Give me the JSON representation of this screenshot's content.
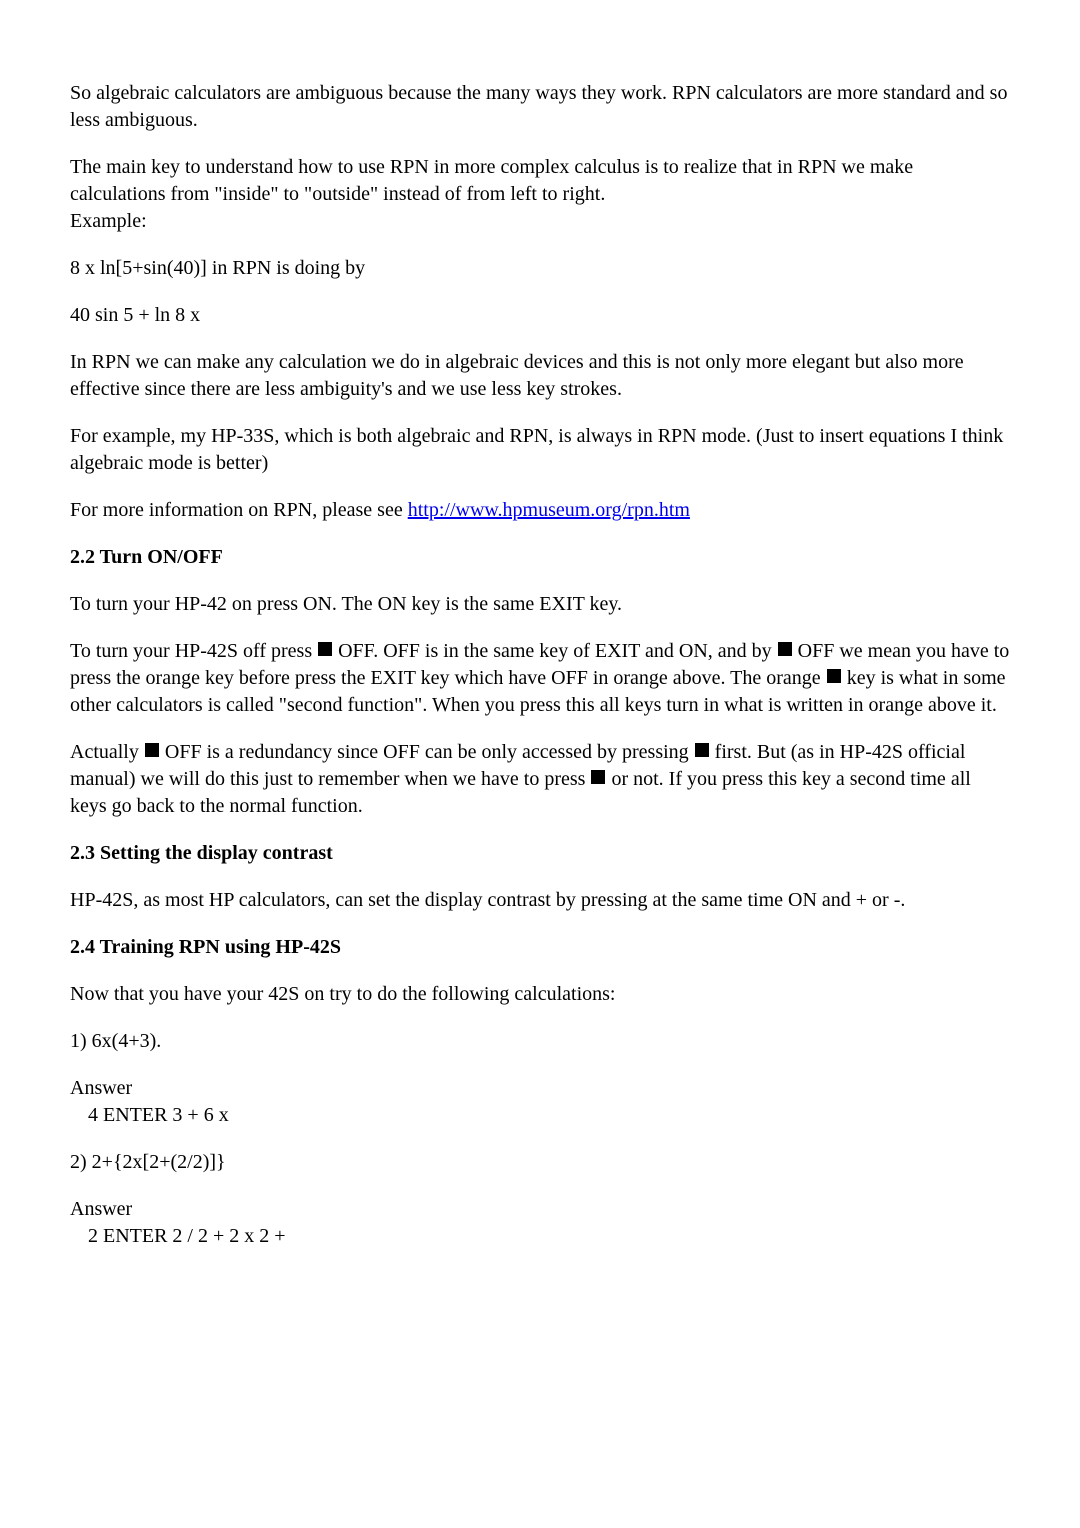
{
  "p1": "So algebraic calculators are ambiguous because the many ways they work. RPN calculators are more standard and so less ambiguous.",
  "p2": "The main key to understand how to use RPN in more complex calculus is to realize that in RPN we make calculations from \"inside\" to \"outside\" instead of from left to right.",
  "p2b": "Example:",
  "p3": "8 x ln[5+sin(40)] in RPN is doing by",
  "p4": "40 sin 5 + ln 8 x",
  "p5": "In RPN we can make any calculation we do in algebraic devices and this is not only more elegant but also more effective since there are less ambiguity's and we use less key strokes.",
  "p6": "For example, my HP-33S, which is both algebraic and RPN, is always in RPN mode. (Just to insert equations I think algebraic mode is better)",
  "p7a": "For more information on RPN, please see ",
  "p7link": "http://www.hpmuseum.org/rpn.htm",
  "h22": "2.2 Turn ON/OFF",
  "p8": "To turn your HP-42 on press ON. The ON key is the same EXIT key.",
  "p9a": "To turn your HP-42S off press ",
  "p9b": " OFF. OFF is in the same key of EXIT and ON, and by ",
  "p9c": " OFF we mean you have to press the orange key before press the EXIT key which have OFF in orange above. The orange ",
  "p9d": " key is what in some other calculators is called \"second function\". When you press this all keys turn in what is written in orange above it.",
  "p10a": "Actually ",
  "p10b": " OFF is a redundancy since OFF can be only accessed by pressing ",
  "p10c": " first. But (as in HP-42S official manual) we will do this just to remember when we have to press ",
  "p10d": " or not. If you press this key a second time all keys go back to the normal function.",
  "h23": "2.3 Setting the display contrast",
  "p11": "HP-42S, as most HP calculators, can set the display contrast by pressing at the same time ON and + or -.",
  "h24": "2.4 Training RPN using HP-42S",
  "p12": " Now that you have your 42S on try to do the following calculations:",
  "p13": "1) 6x(4+3).",
  "p14": "Answer",
  "p14b": "4 ENTER 3 + 6 x",
  "p15": "2) 2+{2x[2+(2/2)]}",
  "p16": "Answer",
  "p16b": "2 ENTER 2 / 2 + 2 x 2 +"
}
